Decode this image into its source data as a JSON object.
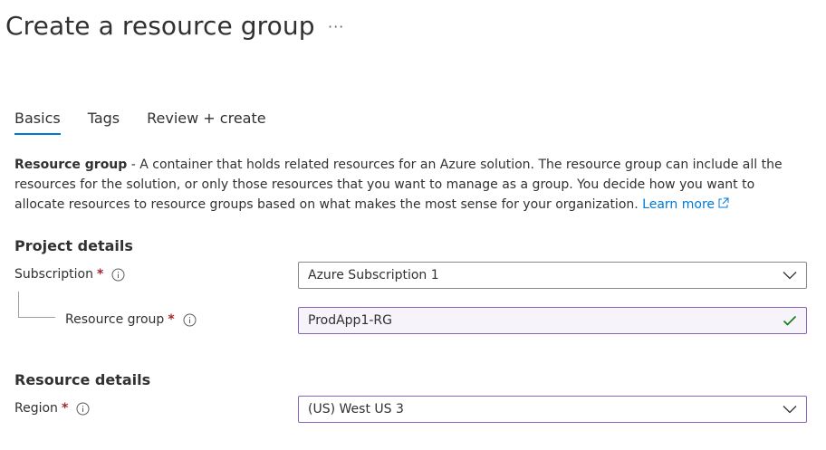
{
  "header": {
    "title": "Create a resource group",
    "more_label": "···"
  },
  "tabs": [
    {
      "label": "Basics",
      "active": true
    },
    {
      "label": "Tags",
      "active": false
    },
    {
      "label": "Review + create",
      "active": false
    }
  ],
  "description": {
    "term": "Resource group",
    "text": " - A container that holds related resources for an Azure solution. The resource group can include all the resources for the solution, or only those resources that you want to manage as a group. You decide how you want to allocate resources to resource groups based on what makes the most sense for your organization. ",
    "learn_more": "Learn more"
  },
  "project_details": {
    "title": "Project details",
    "subscription": {
      "label": "Subscription",
      "required_mark": "*",
      "value": "Azure Subscription 1"
    },
    "resource_group": {
      "label": "Resource group",
      "required_mark": "*",
      "value": "ProdApp1-RG",
      "validation": "valid"
    }
  },
  "resource_details": {
    "title": "Resource details",
    "region": {
      "label": "Region",
      "required_mark": "*",
      "value": "(US) West US 3"
    }
  },
  "colors": {
    "accent": "#0078d4",
    "required": "#a4262c",
    "focus_border": "#8764b8",
    "success": "#107c10"
  },
  "icons": {
    "info": "info-icon",
    "chevron": "chevron-down-icon",
    "check": "checkmark-icon",
    "external": "external-link-icon"
  }
}
